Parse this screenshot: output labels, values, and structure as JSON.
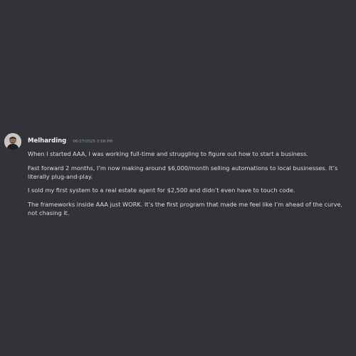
{
  "message": {
    "author": "Melharding",
    "timestamp": "06/27/2025 3:58 PM",
    "paragraphs": [
      "When I started AAA, I was working full-time and struggling to figure out how to start a business.",
      "Fast forward 2 months, I’m now making around $6,000/month selling automations to local businesses. It’s literally plug-and-play.",
      "I sold my first system to a real estate agent for $2,500 and didn’t even have to touch code.",
      "The frameworks inside AAA just WORK. It’s the first program that made me feel like I’m ahead of the curve, not chasing it."
    ]
  },
  "colors": {
    "background": "#313338",
    "username": "#f2f3f5",
    "text": "#dbdee1",
    "timestamp": "#949ba4"
  }
}
